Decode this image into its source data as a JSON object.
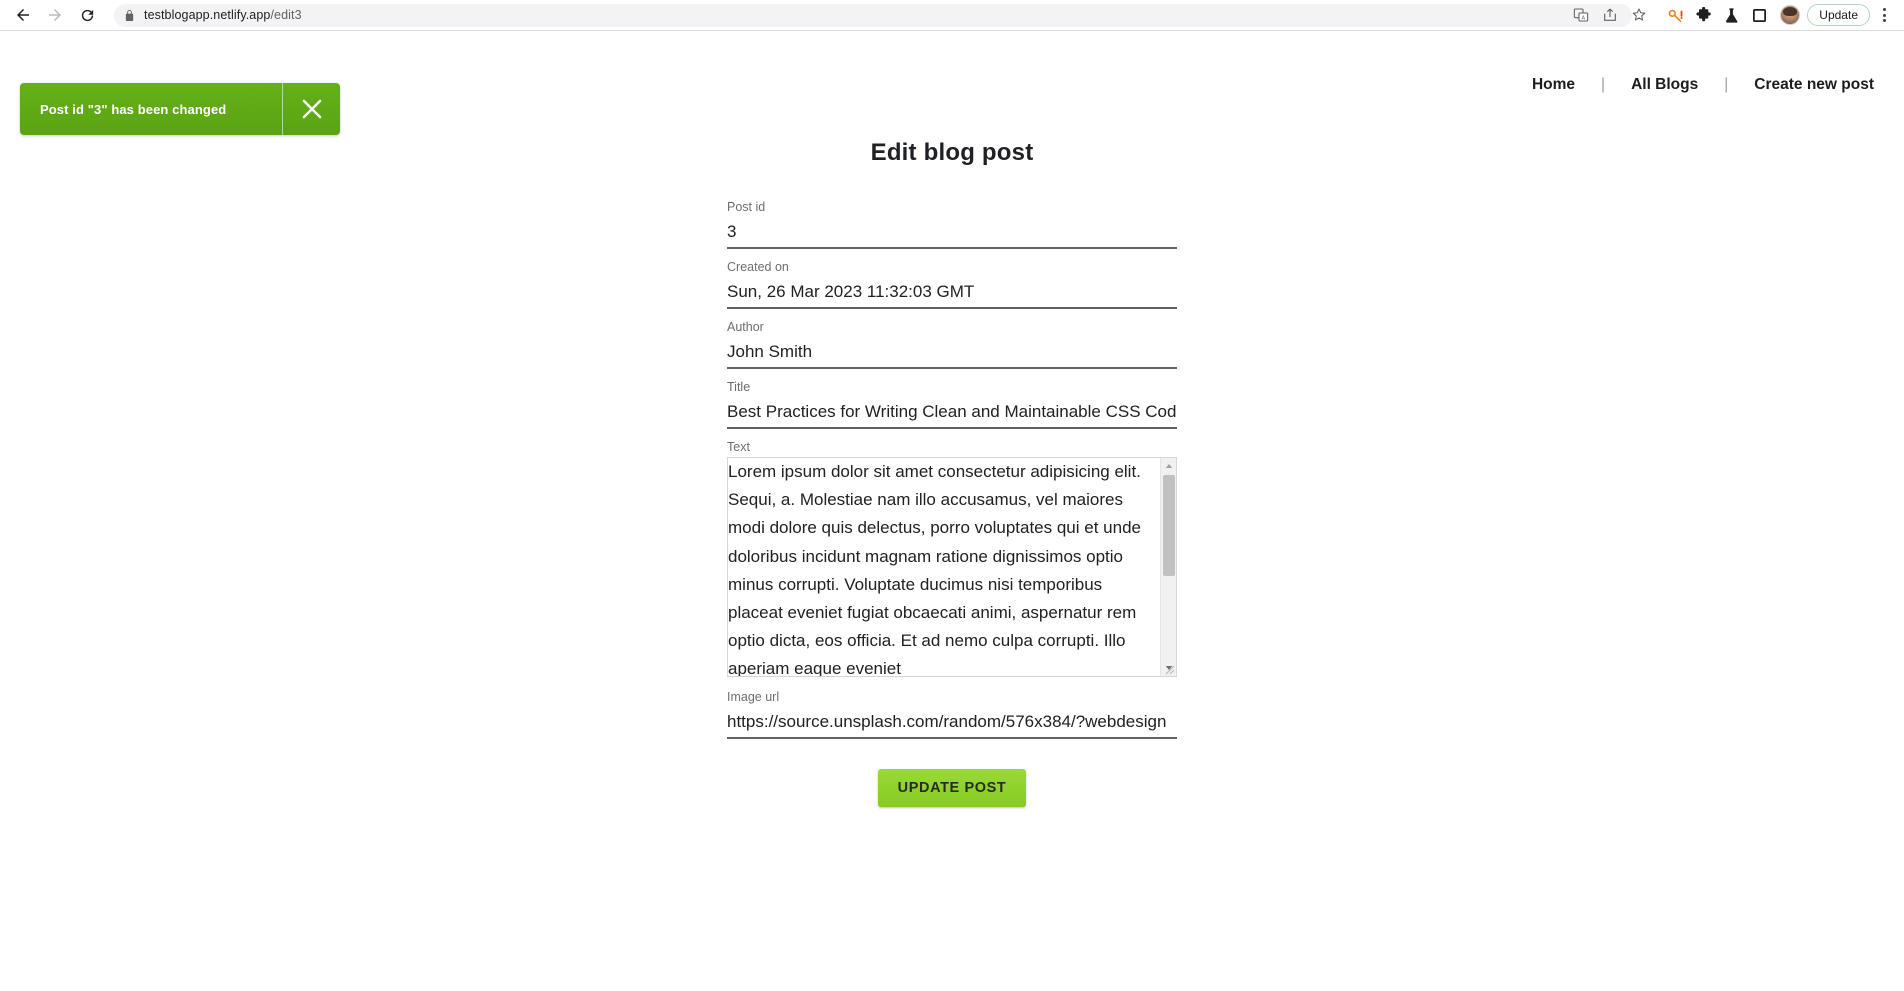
{
  "browser": {
    "back_label": "back-arrow",
    "forward_label": "forward-arrow",
    "reload_label": "reload",
    "url_domain": "testblogapp.netlify.app",
    "url_path": "/edit3",
    "update_button": "Update",
    "toolbar_icons": [
      "translate-icon",
      "share-icon",
      "bookmark-star-icon",
      "password-key-icon",
      "extensions-puzzle-icon",
      "lab-flask-icon",
      "square-panel-icon",
      "profile-avatar",
      "update-button",
      "kebab-menu-icon"
    ]
  },
  "toast": {
    "message": "Post id \"3\" has been changed",
    "close_label": "close-icon",
    "background_color": "#5fa916",
    "text_color": "#ffffff"
  },
  "topnav": {
    "items": [
      {
        "label": "Home"
      },
      {
        "label": "All Blogs"
      },
      {
        "label": "Create new post"
      }
    ],
    "separator": "|"
  },
  "form": {
    "title": "Edit blog post",
    "fields": [
      {
        "label": "Post id",
        "value": "3"
      },
      {
        "label": "Created on",
        "value": "Sun, 26 Mar 2023 11:32:03 GMT"
      },
      {
        "label": "Author",
        "value": "John Smith"
      },
      {
        "label": "Title",
        "value": "Best Practices for Writing Clean and Maintainable CSS Code"
      },
      {
        "label": "Text",
        "value": "Lorem ipsum dolor sit amet consectetur adipisicing elit. Sequi, a. Molestiae nam illo accusamus, vel maiores modi dolore quis delectus, porro voluptates qui et unde doloribus incidunt magnam ratione dignissimos optio minus corrupti. Voluptate ducimus nisi temporibus placeat eveniet fugiat obcaecati animi, aspernatur rem optio dicta, eos officia. Et ad nemo culpa corrupti. Illo aperiam eaque eveniet"
      },
      {
        "label": "Image url",
        "value": "https://source.unsplash.com/random/576x384/?webdesign"
      }
    ],
    "submit_label": "UPDATE POST",
    "submit_color": "#8ed02b"
  }
}
